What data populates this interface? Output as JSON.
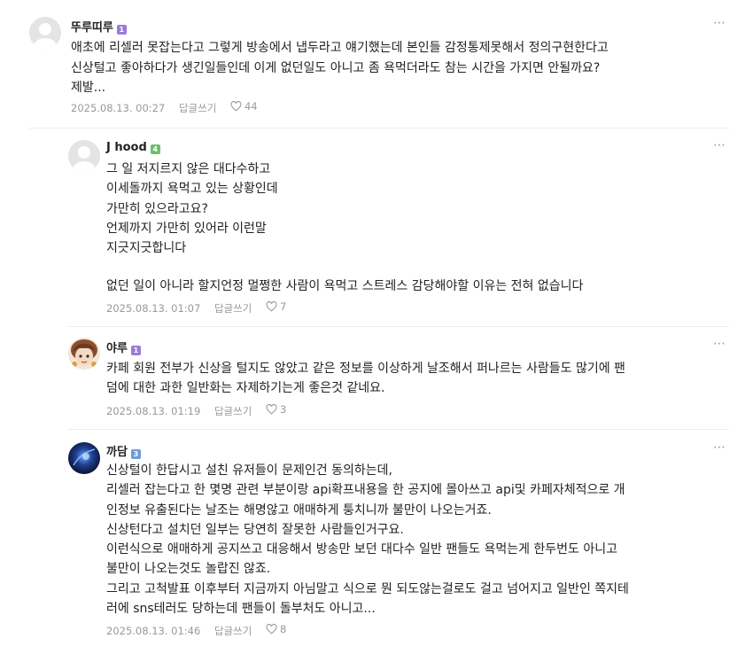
{
  "colors": {
    "badge_purple": "#9b7ad8",
    "badge_green": "#6cc06c",
    "badge_blue": "#6f9bd8",
    "meta_gray": "#999999",
    "divider": "#ececec"
  },
  "common": {
    "reply_label": "답글쓰기",
    "more_icon": "⋯"
  },
  "comments": [
    {
      "nickname": "뚜루띠루",
      "badge": "1",
      "avatar": "default-avatar",
      "lines": [
        "애초에 리셀러 못잡는다고 그렇게 방송에서 냅두라고 얘기했는데 본인들 감정통제못해서 정의구현한다고",
        "신상털고 좋아하다가 생긴일들인데 이게 없던일도 아니고 좀 욕먹더라도 참는 시간을 가지면 안될까요?",
        "제발..."
      ],
      "date": "2025.08.13. 00:27",
      "likes": "44"
    },
    {
      "nickname": "J hood",
      "badge": "4",
      "avatar": "default-avatar",
      "lines": [
        "그 일 저지르지 않은 대다수하고",
        "이세돌까지 욕먹고 있는 상황인데",
        "가만히 있으라고요?",
        "언제까지 가만히 있어라 이런말",
        "지긋지긋합니다",
        "",
        "없던 일이 아니라 할지언정 멀쩡한 사람이 욕먹고 스트레스 감당해야할 이유는 전혀 없습니다"
      ],
      "date": "2025.08.13. 01:07",
      "likes": "7"
    },
    {
      "nickname": "야루",
      "badge": "1",
      "avatar": "character-avatar",
      "lines": [
        "카페 회원 전부가 신상을 털지도 않았고 같은 정보를 이상하게 날조해서 퍼나르는 사람들도 많기에 팬",
        "덤에 대한 과한 일반화는 자제하기는게 좋은것 같네요."
      ],
      "date": "2025.08.13. 01:19",
      "likes": "3"
    },
    {
      "nickname": "까담",
      "badge": "3",
      "avatar": "blue-avatar",
      "lines": [
        "신상털이 한답시고 설친 유저들이 문제인건 동의하는데,",
        "리셀러 잡는다고 한 몇명 관련 부분이랑 api확프내용을 한 공지에 몰아쓰고 api및 카페자체적으로 개",
        "인정보 유출된다는 날조는 해명않고 애매하게 퉁치니까 불만이 나오는거죠.",
        "신상턴다고 설치던 일부는 당연히 잘못한 사람들인거구요.",
        "이런식으로 애매하게 공지쓰고 대응해서 방송만 보던 대다수 일반 팬들도 욕먹는게 한두번도 아니고",
        "불만이 나오는것도 놀랍진 않죠.",
        "그리고 고척발표 이후부터 지금까지 아님말고 식으로 뭔 되도않는걸로도 걸고 넘어지고 일반인 쪽지테",
        "러에 sns테러도 당하는데 팬들이 돌부처도 아니고..."
      ],
      "date": "2025.08.13. 01:46",
      "likes": "8"
    }
  ]
}
